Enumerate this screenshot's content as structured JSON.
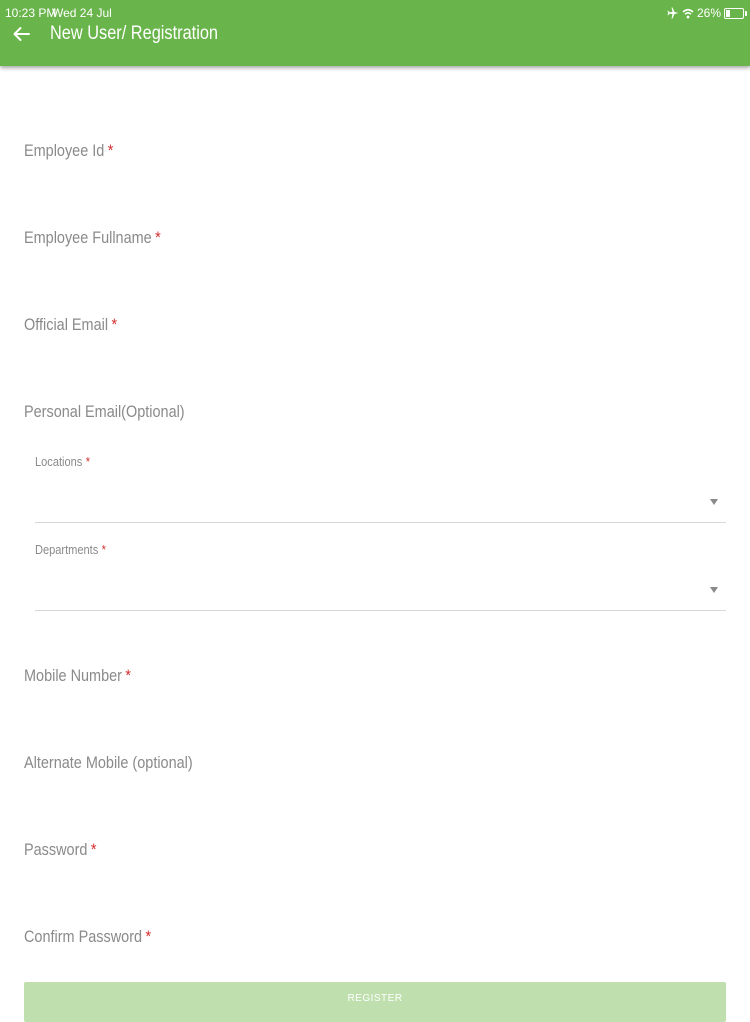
{
  "status_bar": {
    "time": "10:23 PM",
    "date": "Wed 24 Jul",
    "battery": "26%",
    "icons": [
      "airplane-icon",
      "wifi-icon",
      "battery-icon"
    ]
  },
  "header": {
    "title": "New User/ Registration",
    "back_icon": "arrow-left-icon",
    "color": "#6ab54b"
  },
  "form": {
    "required_mark": "*",
    "employee_id": {
      "label": "Employee Id",
      "required": true,
      "value": ""
    },
    "employee_fullname": {
      "label": "Employee Fullname",
      "required": true,
      "value": ""
    },
    "official_email": {
      "label": "Official Email",
      "required": true,
      "value": ""
    },
    "personal_email": {
      "label": "Personal Email(Optional)",
      "required": false,
      "value": ""
    },
    "locations": {
      "label": "Locations",
      "required": true,
      "value": ""
    },
    "departments": {
      "label": "Departments",
      "required": true,
      "value": ""
    },
    "mobile_number": {
      "label": "Mobile Number",
      "required": true,
      "value": ""
    },
    "alternate_mobile": {
      "label": "Alternate Mobile (optional)",
      "required": false,
      "value": ""
    },
    "password": {
      "label": "Password",
      "required": true,
      "value": ""
    },
    "confirm_password": {
      "label": "Confirm Password",
      "required": true,
      "value": ""
    },
    "submit_label": "REGISTER"
  }
}
